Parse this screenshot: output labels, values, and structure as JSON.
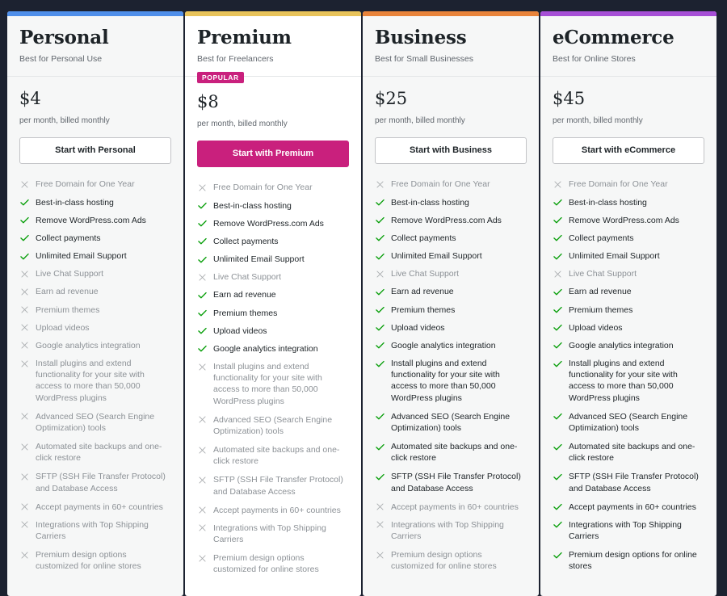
{
  "page": {
    "background_color": "#1c2230",
    "card_background": "#f6f7f7",
    "card_background_featured": "#ffffff",
    "text_color": "#1d2327",
    "muted_text_color": "#8c9196",
    "check_color": "#069e08",
    "cross_color": "#a7aaad"
  },
  "features": [
    "Free Domain for One Year",
    "Best-in-class hosting",
    "Remove WordPress.com Ads",
    "Collect payments",
    "Unlimited Email Support",
    "Live Chat Support",
    "Earn ad revenue",
    "Premium themes",
    "Upload videos",
    "Google analytics integration",
    "Install plugins and extend functionality for your site with access to more than 50,000 WordPress plugins",
    "Advanced SEO (Search Engine Optimization) tools",
    "Automated site backups and one-click restore",
    "SFTP (SSH File Transfer Protocol) and Database Access",
    "Accept payments in 60+ countries",
    "Integrations with Top Shipping Carriers",
    "Premium design options customized for online stores"
  ],
  "plans": [
    {
      "name": "Personal",
      "tagline": "Best for Personal Use",
      "accent_color": "#4f8fea",
      "badge": null,
      "price": "$4",
      "price_note": "per month, billed monthly",
      "cta_label": "Start with Personal",
      "cta_style": "secondary",
      "featured": false,
      "feature_labels": [
        "Free Domain for One Year",
        "Best-in-class hosting",
        "Remove WordPress.com Ads",
        "Collect payments",
        "Unlimited Email Support",
        "Live Chat Support",
        "Earn ad revenue",
        "Premium themes",
        "Upload videos",
        "Google analytics integration",
        "Install plugins and extend functionality for your site with access to more than 50,000 WordPress plugins",
        "Advanced SEO (Search Engine Optimization) tools",
        "Automated site backups and one-click restore",
        "SFTP (SSH File Transfer Protocol) and Database Access",
        "Accept payments in 60+ countries",
        "Integrations with Top Shipping Carriers",
        "Premium design options customized for online stores"
      ],
      "feature_states": [
        false,
        true,
        true,
        true,
        true,
        false,
        false,
        false,
        false,
        false,
        false,
        false,
        false,
        false,
        false,
        false,
        false
      ]
    },
    {
      "name": "Premium",
      "tagline": "Best for Freelancers",
      "accent_color": "#e8c35a",
      "badge": "POPULAR",
      "price": "$8",
      "price_note": "per month, billed monthly",
      "cta_label": "Start with Premium",
      "cta_style": "primary",
      "featured": true,
      "feature_labels": [
        "Free Domain for One Year",
        "Best-in-class hosting",
        "Remove WordPress.com Ads",
        "Collect payments",
        "Unlimited Email Support",
        "Live Chat Support",
        "Earn ad revenue",
        "Premium themes",
        "Upload videos",
        "Google analytics integration",
        "Install plugins and extend functionality for your site with access to more than 50,000 WordPress plugins",
        "Advanced SEO (Search Engine Optimization) tools",
        "Automated site backups and one-click restore",
        "SFTP (SSH File Transfer Protocol) and Database Access",
        "Accept payments in 60+ countries",
        "Integrations with Top Shipping Carriers",
        "Premium design options customized for online stores"
      ],
      "feature_states": [
        false,
        true,
        true,
        true,
        true,
        false,
        true,
        true,
        true,
        true,
        false,
        false,
        false,
        false,
        false,
        false,
        false
      ]
    },
    {
      "name": "Business",
      "tagline": "Best for Small Businesses",
      "accent_color": "#e8833a",
      "badge": null,
      "price": "$25",
      "price_note": "per month, billed monthly",
      "cta_label": "Start with Business",
      "cta_style": "secondary",
      "featured": false,
      "feature_labels": [
        "Free Domain for One Year",
        "Best-in-class hosting",
        "Remove WordPress.com Ads",
        "Collect payments",
        "Unlimited Email Support",
        "Live Chat Support",
        "Earn ad revenue",
        "Premium themes",
        "Upload videos",
        "Google analytics integration",
        "Install plugins and extend functionality for your site with access to more than 50,000 WordPress plugins",
        "Advanced SEO (Search Engine Optimization) tools",
        "Automated site backups and one-click restore",
        "SFTP (SSH File Transfer Protocol) and Database Access",
        "Accept payments in 60+ countries",
        "Integrations with Top Shipping Carriers",
        "Premium design options customized for online stores"
      ],
      "feature_states": [
        false,
        true,
        true,
        true,
        true,
        false,
        true,
        true,
        true,
        true,
        true,
        true,
        true,
        true,
        false,
        false,
        false
      ]
    },
    {
      "name": "eCommerce",
      "tagline": "Best for Online Stores",
      "accent_color": "#a64fd6",
      "badge": null,
      "price": "$45",
      "price_note": "per month, billed monthly",
      "cta_label": "Start with eCommerce",
      "cta_style": "secondary",
      "featured": false,
      "feature_labels": [
        "Free Domain for One Year",
        "Best-in-class hosting",
        "Remove WordPress.com Ads",
        "Collect payments",
        "Unlimited Email Support",
        "Live Chat Support",
        "Earn ad revenue",
        "Premium themes",
        "Upload videos",
        "Google analytics integration",
        "Install plugins and extend functionality for your site with access to more than 50,000 WordPress plugins",
        "Advanced SEO (Search Engine Optimization) tools",
        "Automated site backups and one-click restore",
        "SFTP (SSH File Transfer Protocol) and Database Access",
        "Accept payments in 60+ countries",
        "Integrations with Top Shipping Carriers",
        "Premium design options for online stores"
      ],
      "feature_states": [
        false,
        true,
        true,
        true,
        true,
        false,
        true,
        true,
        true,
        true,
        true,
        true,
        true,
        true,
        true,
        true,
        true
      ]
    }
  ],
  "icons": {
    "check": "check-icon",
    "cross": "cross-icon"
  }
}
